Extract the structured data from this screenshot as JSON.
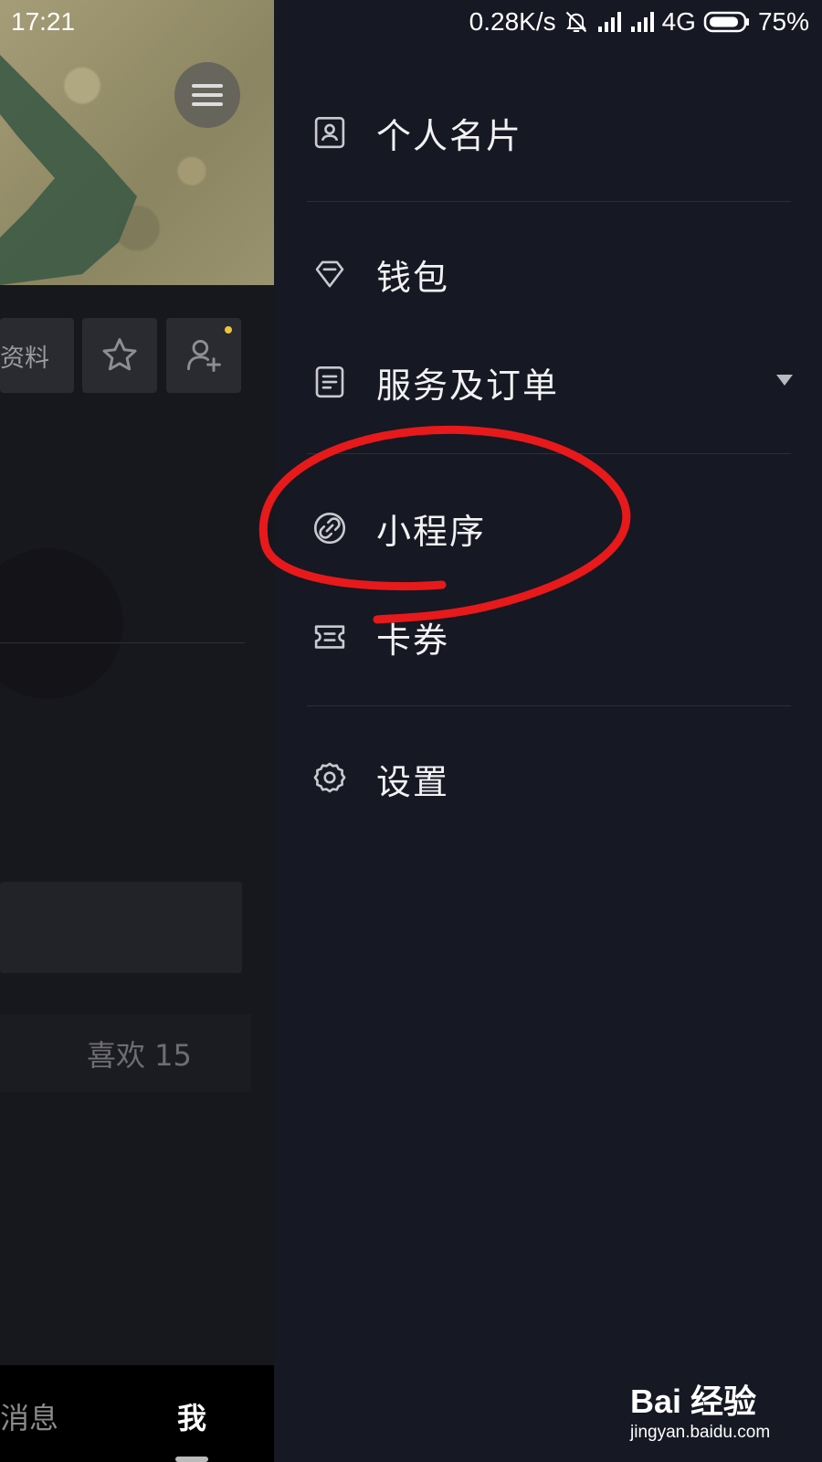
{
  "status_bar": {
    "time": "17:21",
    "network_speed": "0.28K/s",
    "network_type": "4G",
    "battery": "75%",
    "icons": [
      "mute-icon",
      "signal-icon",
      "signal-icon",
      "battery-icon"
    ]
  },
  "profile": {
    "edit_profile_label": "资料",
    "likes_label": "喜欢 15",
    "nav": {
      "messages_label": "消息",
      "me_label": "我"
    }
  },
  "drawer": {
    "items": [
      {
        "label": "个人名片",
        "icon": "profile-card-icon"
      },
      {
        "label": "钱包",
        "icon": "wallet-diamond-icon"
      },
      {
        "label": "服务及订单",
        "icon": "orders-icon"
      },
      {
        "label": "小程序",
        "icon": "link-icon"
      },
      {
        "label": "卡券",
        "icon": "coupon-icon"
      },
      {
        "label": "设置",
        "icon": "gear-icon"
      }
    ]
  },
  "watermark": {
    "brand": "Bai 经验",
    "url": "jingyan.baidu.com"
  },
  "colors": {
    "drawer_bg": "#161823",
    "annotation": "#e8191b",
    "notification_dot": "#f0c33c"
  }
}
